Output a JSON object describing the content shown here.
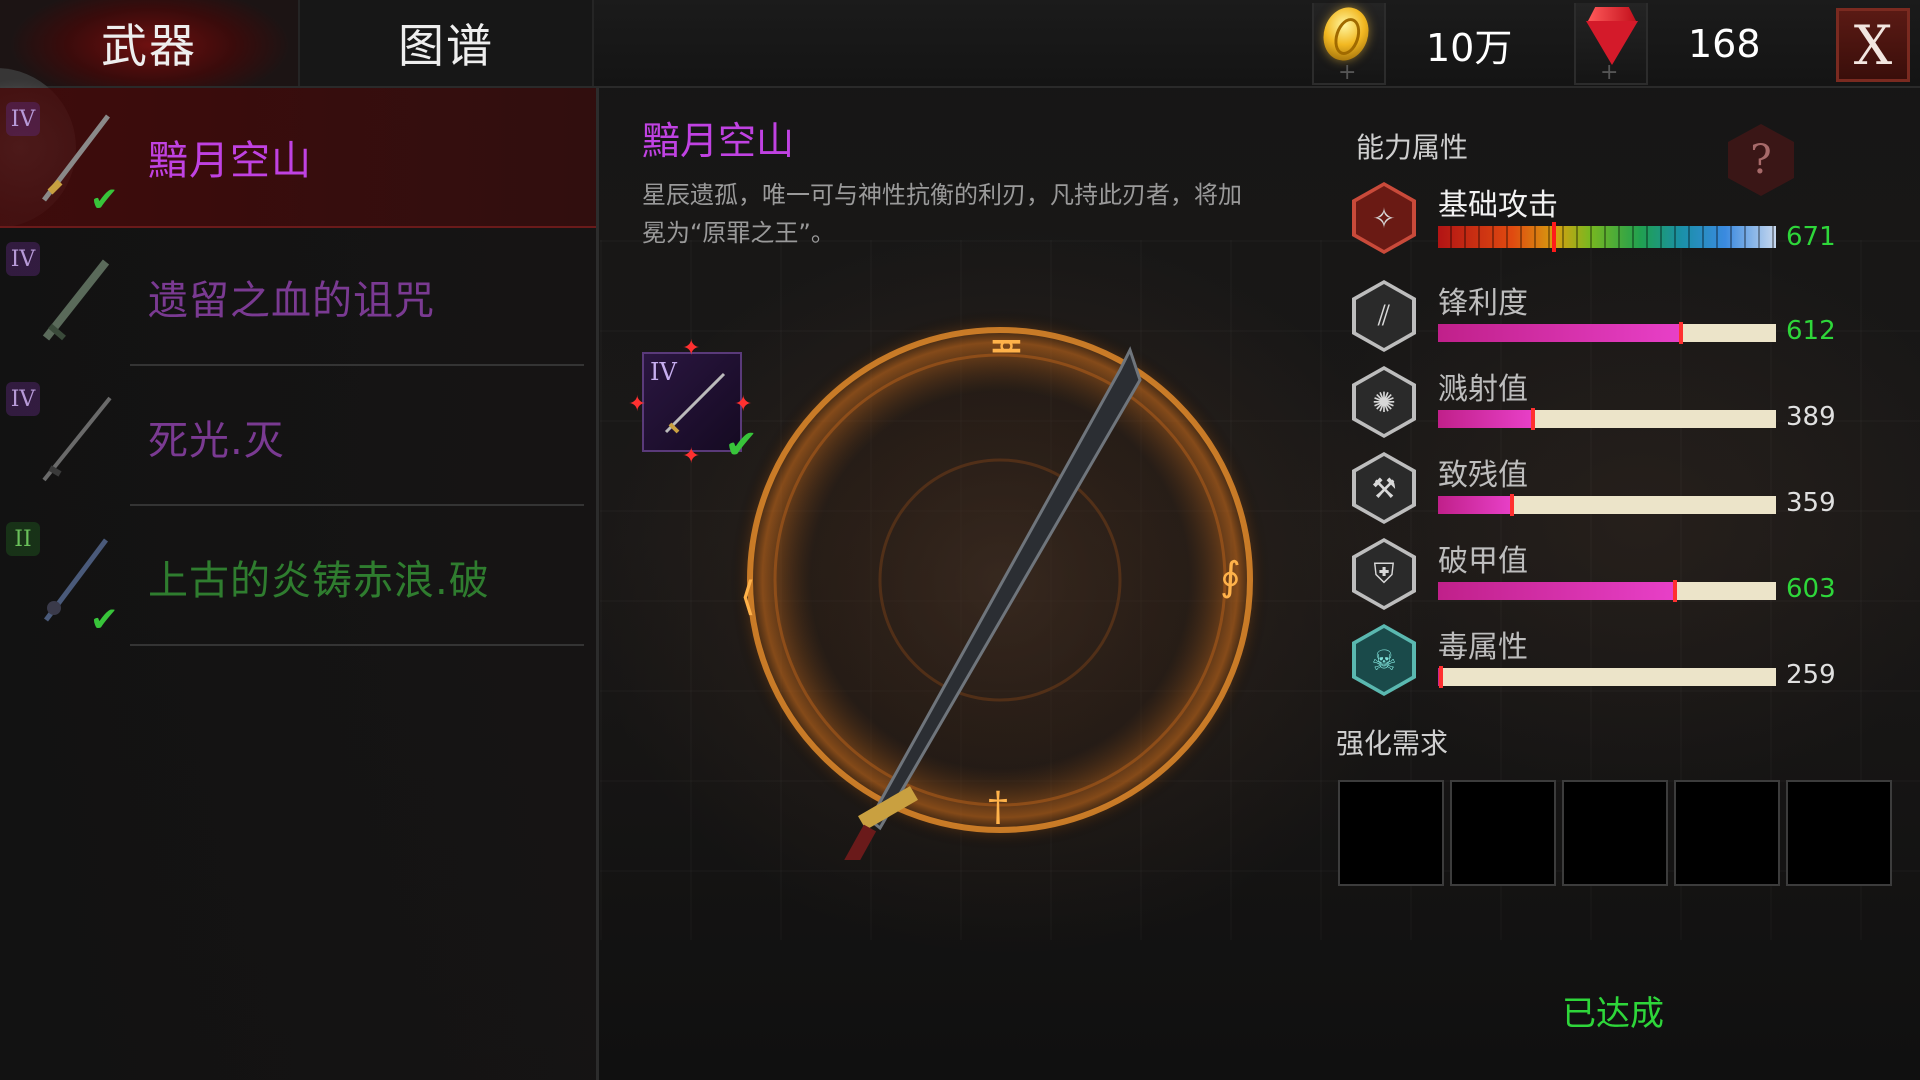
{
  "tabs": {
    "weapons": "武器",
    "codex": "图谱"
  },
  "currency": {
    "coins": "10万",
    "gems": "168",
    "close": "X",
    "coin_plus": "+",
    "gem_plus": "+"
  },
  "weapons_list": [
    {
      "tier": "IV",
      "name": "黯月空山",
      "color": "#c042e2",
      "checked": true,
      "selected": true
    },
    {
      "tier": "IV",
      "name": "遗留之血的诅咒",
      "color": "#7a3a92",
      "checked": false,
      "selected": false
    },
    {
      "tier": "IV",
      "name": "死光.灭",
      "color": "#7a3a92",
      "checked": false,
      "selected": false
    },
    {
      "tier": "II",
      "name": "上古的炎铸赤浪.破",
      "color": "#2f7d2f",
      "checked": true,
      "selected": false
    }
  ],
  "detail": {
    "title": "黯月空山",
    "description": "星辰遗孤，唯一可与神性抗衡的利刃，凡持此刃者，将加冕为“原罪之王”。",
    "card_tier": "IV"
  },
  "stats": {
    "section_title": "能力属性",
    "help": "?",
    "items": [
      {
        "icon": "sword-crest-icon",
        "label": "基础攻击",
        "value": "671",
        "value_color": "#2ed63a",
        "fill": 1.0,
        "style": "rainbow"
      },
      {
        "icon": "slash-icon",
        "label": "锋利度",
        "value": "612",
        "value_color": "#2ed63a",
        "fill": 0.72,
        "style": "bar"
      },
      {
        "icon": "splash-icon",
        "label": "溅射值",
        "value": "389",
        "value_color": "#e0e0e0",
        "fill": 0.28,
        "style": "bar"
      },
      {
        "icon": "cripple-icon",
        "label": "致残值",
        "value": "359",
        "value_color": "#e0e0e0",
        "fill": 0.22,
        "style": "bar"
      },
      {
        "icon": "armor-break-icon",
        "label": "破甲值",
        "value": "603",
        "value_color": "#2ed63a",
        "fill": 0.7,
        "style": "bar"
      },
      {
        "icon": "skull-poison-icon",
        "label": "毒属性",
        "value": "259",
        "value_color": "#e0e0e0",
        "fill": 0.0,
        "style": "bar"
      }
    ]
  },
  "upgrade": {
    "section_title": "强化需求",
    "slots": 5,
    "status": "已达成"
  }
}
